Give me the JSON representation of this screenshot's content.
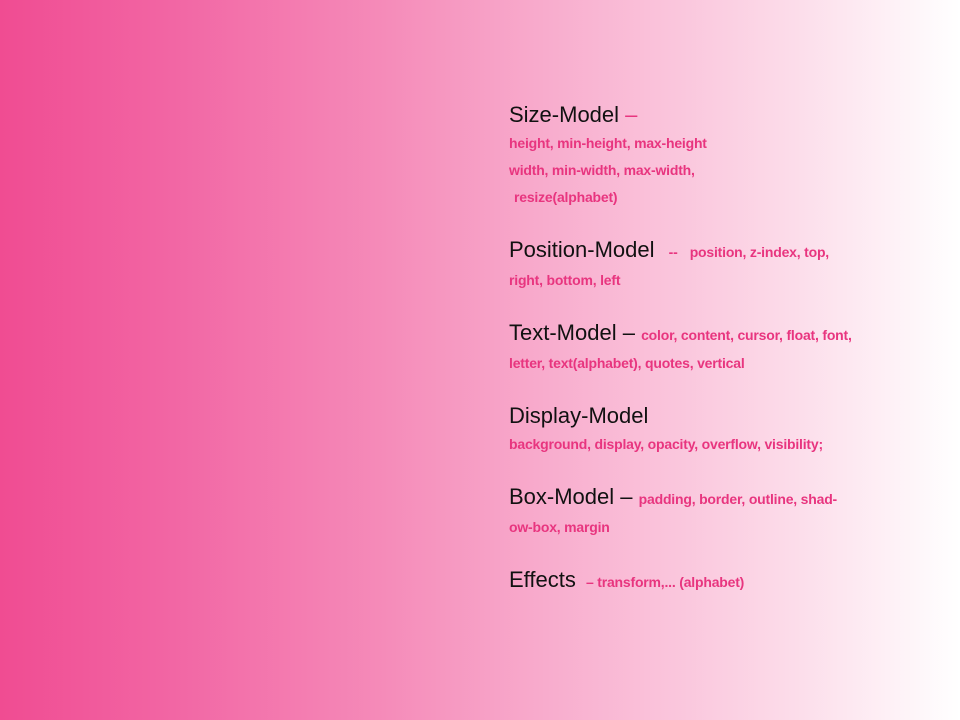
{
  "sections": [
    {
      "title": "Size-Model",
      "dash": "–",
      "inline": "",
      "lines": [
        "height, min-height,  max-height",
        "width, min-width,  max-width,",
        "resize(alphabet)"
      ]
    },
    {
      "title": "Position-Model",
      "dash": "--",
      "inline": "position,  z-index,  top,",
      "lines": [
        "right,  bottom,  left"
      ]
    },
    {
      "title": "Text-Model",
      "dash": "–",
      "inline": "color, content,  cursor, float, font,",
      "lines": [
        "letter, text(alphabet), quotes, vertical"
      ]
    },
    {
      "title": "Display-Model",
      "dash": "",
      "inline": "",
      "lines": [
        "background, display, opacity, overflow, visibility;"
      ]
    },
    {
      "title": "Box-Model",
      "dash": "–",
      "inline": "padding,  border,  outline,  shad-",
      "lines": [
        "ow-box, margin"
      ]
    },
    {
      "title": "Effects",
      "dash": "",
      "inline": "– transform,... (alphabet)",
      "lines": []
    }
  ]
}
